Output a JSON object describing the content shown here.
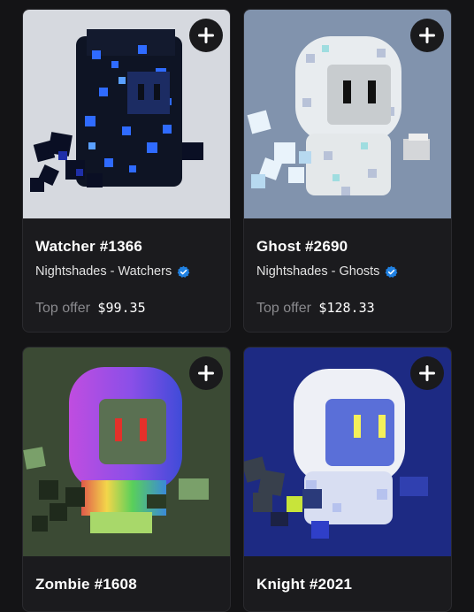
{
  "cards": [
    {
      "title": "Watcher #1366",
      "collection": "Nightshades - Watchers",
      "offer_label": "Top offer",
      "offer_value": "$99.35",
      "background": "#d6d9df",
      "verified": true
    },
    {
      "title": "Ghost #2690",
      "collection": "Nightshades - Ghosts",
      "offer_label": "Top offer",
      "offer_value": "$128.33",
      "background": "#8193ad",
      "verified": true
    },
    {
      "title": "Zombie #1608",
      "background": "#3b4a34"
    },
    {
      "title": "Knight #2021",
      "background": "#1d2a83"
    }
  ],
  "colors": {
    "page_bg": "#141416",
    "card_bg": "#1b1b1e",
    "verified_blue": "#2081e2",
    "offer_label": "#8a8a8e"
  }
}
